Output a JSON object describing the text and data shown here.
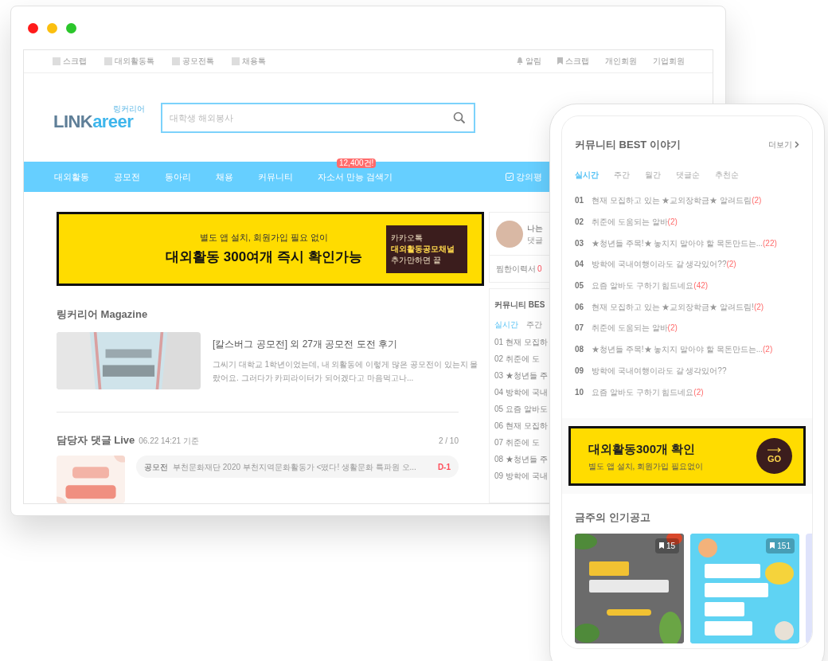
{
  "browser": {
    "utility_left": [
      "스크랩",
      "대외활동톡",
      "공모전톡",
      "채용톡"
    ],
    "utility_right": [
      {
        "label": "알림",
        "kind": "bell"
      },
      {
        "label": "스크랩",
        "kind": "bookmark"
      },
      {
        "label": "개인회원",
        "kind": "text"
      },
      {
        "label": "기업회원",
        "kind": "text"
      }
    ],
    "logo": {
      "sub": "링커리어",
      "main": "LINK",
      "accent": "areer"
    },
    "search": {
      "placeholder": "대학생 해외봉사"
    },
    "nav": [
      {
        "label": "대외활동"
      },
      {
        "label": "공모전"
      },
      {
        "label": "동아리"
      },
      {
        "label": "채용"
      },
      {
        "label": "커뮤니티"
      },
      {
        "label": "자소서 만능 검색기",
        "badge": "12,400건!"
      }
    ],
    "nav_right": "강의평",
    "banner": {
      "subtitle": "별도 앱 설치, 회원가입 필요 없이",
      "title": "대외활동 300여개 즉시 확인가능",
      "side_lines": [
        "카카오톡",
        "대외활동공모채널",
        "추가만하면 끝"
      ]
    },
    "magazine": {
      "heading": "링커리어 Magazine",
      "title": "[칼스버그 공모전] 외 27개 공모전 도전 후기",
      "summary": "그씨기 대학교 1학년이었는데, 내 외활동에 이렇게 많은 공모전이 있는지 몰랐어요. 그러다가 카피라이터가 되어겠다고 마음먹고나..."
    },
    "live": {
      "heading": "담당자 댓글 Live",
      "time": "06.22 14:21 기준",
      "page": "2 / 10",
      "rows": [
        {
          "tag": "공모전",
          "text": "부천문화재단 2020 부천지역문화활동가 <떴다! 생활문화 특파원 오...",
          "dday": "D-1"
        }
      ]
    },
    "sidebar": {
      "name": "나는",
      "sub": "댓글",
      "stat_label": "찜한이력서",
      "stat_value": "0",
      "heading": "커뮤니티 BES",
      "tabs": [
        {
          "label": "실시간",
          "selected": true
        },
        {
          "label": "주간",
          "selected": false
        }
      ],
      "items": [
        {
          "num": "01",
          "text": "현재 모집하"
        },
        {
          "num": "02",
          "text": "취준에 도"
        },
        {
          "num": "03",
          "text": "★청년들 주"
        },
        {
          "num": "04",
          "text": "방학에 국내"
        },
        {
          "num": "05",
          "text": "요즘 알바도"
        },
        {
          "num": "06",
          "text": "현재 모집하"
        },
        {
          "num": "07",
          "text": "취준에 도"
        },
        {
          "num": "08",
          "text": "★청년들 주"
        },
        {
          "num": "09",
          "text": "방학에 국내"
        }
      ]
    }
  },
  "phone": {
    "heading": "커뮤니티 BEST 이야기",
    "more": "더보기",
    "tabs": [
      {
        "label": "실시간",
        "selected": true
      },
      {
        "label": "주간",
        "selected": false
      },
      {
        "label": "월간",
        "selected": false
      },
      {
        "label": "댓글순",
        "selected": false
      },
      {
        "label": "추천순",
        "selected": false
      }
    ],
    "items": [
      {
        "num": "01",
        "text": "현재 모집하고 있는 ★교외장학금★ 알려드림",
        "count": "(2)"
      },
      {
        "num": "02",
        "text": "취준에 도움되는 알바",
        "count": "(2)"
      },
      {
        "num": "03",
        "text": "★청년들 주목!★ 놓치지 말아야 할 목돈만드는...",
        "count": "(22)"
      },
      {
        "num": "04",
        "text": "방학에 국내여행이라도 갈 생각있어??",
        "count": "(2)"
      },
      {
        "num": "05",
        "text": "요즘 알바도 구하기 힘드네요",
        "count": "(42)"
      },
      {
        "num": "06",
        "text": "현재 모집하고 있는 ★교외장학금★ 알려드림!",
        "count": "(2)"
      },
      {
        "num": "07",
        "text": "취준에 도움되는 알바",
        "count": "(2)"
      },
      {
        "num": "08",
        "text": "★청년들 주목!★ 놓치지 말아야 할 목돈만드는...",
        "count": "(2)"
      },
      {
        "num": "09",
        "text": "방학에 국내여행이라도 갈 생각있어??"
      },
      {
        "num": "10",
        "text": "요즘 알바도 구하기 힘드네요",
        "count": "(2)"
      }
    ],
    "banner": {
      "title": "대외활동300개 확인",
      "subtitle": "별도 앱 설치, 회원가입 필요없이",
      "button": "GO"
    },
    "popular": {
      "heading": "금주의 인기공고",
      "cards": [
        {
          "bookmarks": "15",
          "color": "#6b6b6b"
        },
        {
          "bookmarks": "151",
          "color": "#5fd3f3"
        }
      ]
    }
  }
}
